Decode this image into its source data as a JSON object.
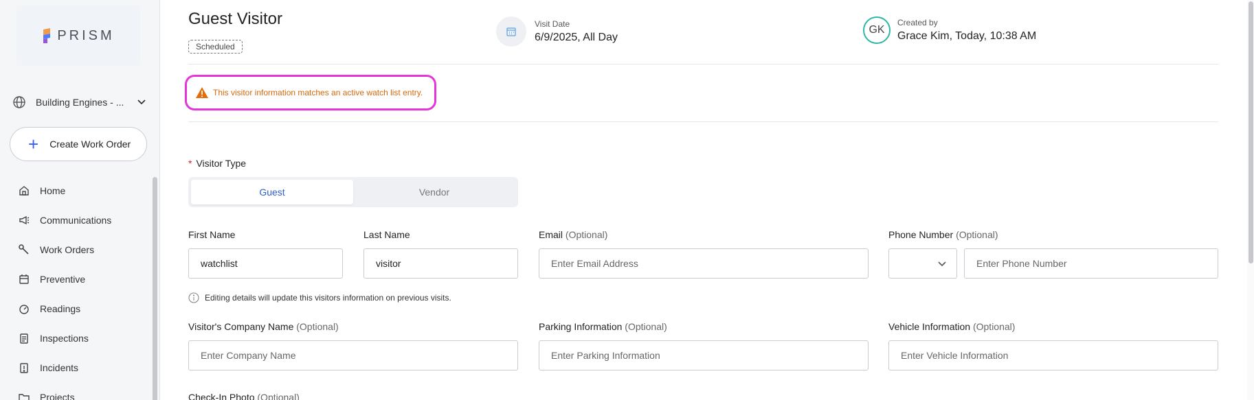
{
  "sidebar": {
    "logo_text": "PRISM",
    "building_label": "Building Engines - ...",
    "create_label": "Create Work Order",
    "items": [
      {
        "label": "Home",
        "icon": "home-icon"
      },
      {
        "label": "Communications",
        "icon": "megaphone-icon"
      },
      {
        "label": "Work Orders",
        "icon": "wrench-icon"
      },
      {
        "label": "Preventive",
        "icon": "calendar-icon"
      },
      {
        "label": "Readings",
        "icon": "gauge-icon"
      },
      {
        "label": "Inspections",
        "icon": "clipboard-icon"
      },
      {
        "label": "Incidents",
        "icon": "alert-note-icon"
      },
      {
        "label": "Projects",
        "icon": "folder-icon"
      }
    ]
  },
  "header": {
    "title": "Guest Visitor",
    "status": "Scheduled",
    "visit_date_label": "Visit Date",
    "visit_date_value": "6/9/2025, All Day",
    "created_by_label": "Created by",
    "created_by_value": "Grace Kim, Today, 10:38 AM",
    "avatar_initials": "GK"
  },
  "alert": {
    "text": "This visitor information matches an active watch list entry."
  },
  "form": {
    "visitor_type_label": "Visitor Type",
    "visitor_type_options": [
      "Guest",
      "Vendor"
    ],
    "visitor_type_selected": "Guest",
    "first_name_label": "First Name",
    "first_name_value": "watchlist",
    "last_name_label": "Last Name",
    "last_name_value": "visitor",
    "email_label": "Email",
    "email_optional": "(Optional)",
    "email_placeholder": "Enter Email Address",
    "phone_label": "Phone Number",
    "phone_optional": "(Optional)",
    "phone_placeholder": "Enter Phone Number",
    "hint_text": "Editing details will update this visitors information on previous visits.",
    "company_label": "Visitor's Company Name",
    "company_optional": "(Optional)",
    "company_placeholder": "Enter Company Name",
    "parking_label": "Parking Information",
    "parking_optional": "(Optional)",
    "parking_placeholder": "Enter Parking Information",
    "vehicle_label": "Vehicle Information",
    "vehicle_optional": "(Optional)",
    "vehicle_placeholder": "Enter Vehicle Information",
    "photo_label": "Check-In Photo",
    "photo_optional": "(Optional)"
  },
  "colors": {
    "accent": "#3d5afe",
    "alert_border": "#e535d9",
    "alert_text": "#d4680b",
    "avatar_ring": "#2bb7a3"
  }
}
